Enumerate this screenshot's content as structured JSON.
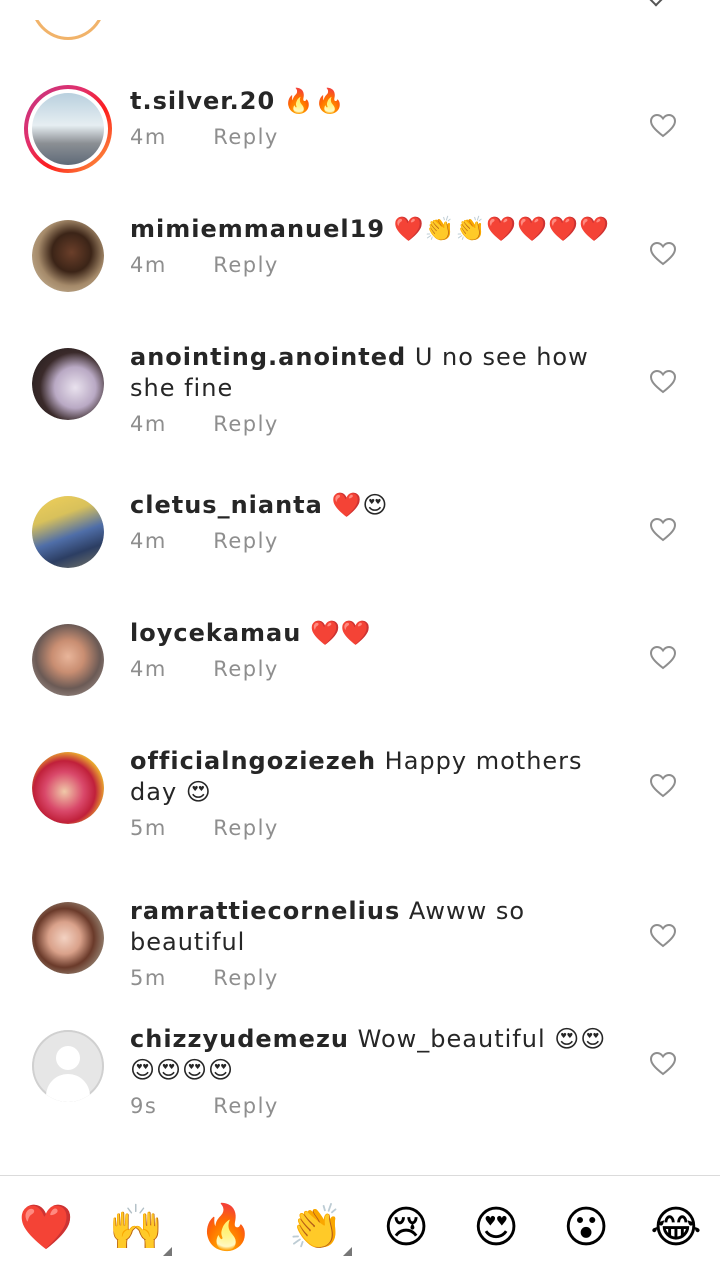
{
  "comments": [
    {
      "username": "t.silver.20",
      "text": "",
      "emoji": "🔥🔥",
      "time": "4m",
      "reply": "Reply"
    },
    {
      "username": "mimiemmanuel19",
      "text": "",
      "emoji": "❤️👏👏❤️❤️❤️❤️",
      "time": "4m",
      "reply": "Reply"
    },
    {
      "username": "anointing.anointed",
      "text": "U no see how she fine",
      "emoji": "",
      "time": "4m",
      "reply": "Reply"
    },
    {
      "username": "cletus_nianta",
      "text": "",
      "emoji": "❤️😍",
      "time": "4m",
      "reply": "Reply"
    },
    {
      "username": "loycekamau",
      "text": "",
      "emoji": "❤️❤️",
      "time": "4m",
      "reply": "Reply"
    },
    {
      "username": "officialngoziezeh",
      "text": "Happy mothers day",
      "emoji": "😍",
      "time": "5m",
      "reply": "Reply"
    },
    {
      "username": "ramrattiecornelius",
      "text": "Awww so beautiful",
      "emoji": "",
      "time": "5m",
      "reply": "Reply"
    },
    {
      "username": "chizzyudemezu",
      "text": "Wow_beautiful",
      "emoji": "😍😍😍😍😍😍",
      "time": "9s",
      "reply": "Reply"
    }
  ],
  "reactions": [
    "❤️",
    "🙌",
    "🔥",
    "👏",
    "😢",
    "😍",
    "😮",
    "😂"
  ],
  "colors": {
    "accent_ring": "#e1306c",
    "muted": "#8e8e8e",
    "text": "#262626",
    "divider": "#dbdbdb"
  },
  "icons": {
    "like": "heart-outline-icon",
    "more": "chevron-down-icon"
  }
}
